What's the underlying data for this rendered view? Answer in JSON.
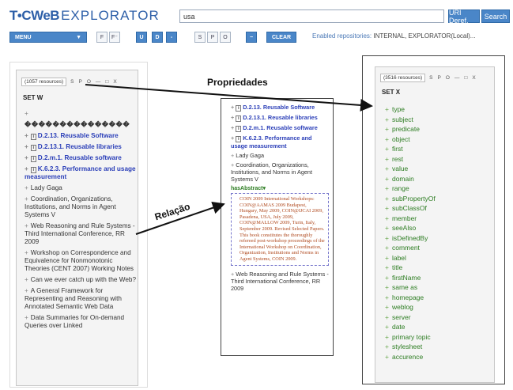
{
  "header": {
    "logo_main": "T•CWeB",
    "logo_sub": "EXPLORATOR",
    "search_value": "usa",
    "uri_button": "URI Deref.",
    "search_button": "Search"
  },
  "toolbar": {
    "menu_label": "MENU",
    "buttons_a": [
      "F",
      "F⁻"
    ],
    "buttons_b": [
      "U",
      "D",
      "-"
    ],
    "buttons_c": [
      "S",
      "P",
      "O"
    ],
    "minus_label": "−",
    "clear_label": "CLEAR",
    "repos_label": "Enabled repositories:",
    "repos_value": "INTERNAL, EXPLORATOR(Local)..."
  },
  "left_panel": {
    "count": "(1057 resources)",
    "controls": [
      "S",
      "P",
      "O",
      "—",
      "□",
      "X"
    ],
    "title": "SET W",
    "items": [
      {
        "text": "",
        "link": false,
        "icon": false
      },
      {
        "text": "���������������",
        "link": false,
        "icon": false,
        "bullet": false
      },
      {
        "text": "D.2.13. Reusable Software",
        "link": true,
        "icon": true
      },
      {
        "text": "D.2.13.1. Reusable libraries",
        "link": true,
        "icon": true
      },
      {
        "text": "D.2.m.1. Reusable software",
        "link": true,
        "icon": true
      },
      {
        "text": "K.6.2.3. Performance and usage measurement",
        "link": true,
        "icon": true
      },
      {
        "text": "Lady Gaga",
        "link": false,
        "icon": false
      },
      {
        "text": "Coordination, Organizations, Institutions, and Norms in Agent Systems V",
        "link": false,
        "icon": false
      },
      {
        "text": "Web Reasoning and Rule Systems - Third International Conference, RR 2009",
        "link": false,
        "icon": false
      },
      {
        "text": "Workshop on Correspondence and Equivalence for Nonmonotonic Theories (CENT 2007) Working Notes",
        "link": false,
        "icon": false
      },
      {
        "text": "Can we ever catch up with the Web?",
        "link": false,
        "icon": false
      },
      {
        "text": "A General Framework for Representing and Reasoning with Annotated Semantic Web Data",
        "link": false,
        "icon": false
      },
      {
        "text": "Data Summaries for On-demand Queries over Linked",
        "link": false,
        "icon": false
      }
    ]
  },
  "middle_panel": {
    "items": [
      {
        "text": "D.2.13. Reusable Software",
        "link": true
      },
      {
        "text": "D.2.13.1. Reusable libraries",
        "link": true
      },
      {
        "text": "D.2.m.1. Reusable software",
        "link": true
      },
      {
        "text": "K.6.2.3. Performance and usage measurement",
        "link": true
      },
      {
        "text": "Lady Gaga",
        "link": false
      },
      {
        "text": "Coordination, Organizations, Institutions, and Norms in Agent Systems V",
        "link": false
      }
    ],
    "abstract_label": "hasAbstract▾",
    "abstract_text": "COIN 2009 International Workshops: COIN@AAMAS 2009 Budapest, Hungary, May 2009, COIN@IJCAI 2009, Pasadena, USA, July 2009, COIN@MALLOW 2009, Turin, Italy, September 2009. Revised Selected Papers. This book constitutes the thoroughly refereed post-workshop proceedings of the International Workshop on Coordination, Organization, Institutions and Norms in Agent Systems, COIN 2009.",
    "footer_item": "Web Reasoning and Rule Systems - Third International Conference, RR 2009"
  },
  "right_panel": {
    "count": "(3516 resources)",
    "controls": [
      "S",
      "P",
      "O",
      "—",
      "□",
      "X"
    ],
    "title": "SET X",
    "properties": [
      "type",
      "subject",
      "predicate",
      "object",
      "first",
      "rest",
      "value",
      "domain",
      "range",
      "subPropertyOf",
      "subClassOf",
      "member",
      "seeAlso",
      "isDefinedBy",
      "comment",
      "label",
      "title",
      "firstName",
      "same as",
      "homepage",
      "weblog",
      "server",
      "date",
      "primary topic",
      "stylesheet",
      "accurence"
    ]
  },
  "annotations": {
    "propriedades": "Propriedades",
    "relacao": "Relação"
  },
  "colors": {
    "accent_blue": "#4a86c8",
    "link_blue": "#2b3fb8",
    "property_green": "#2d7d22",
    "abstract_brown": "#b04a1f"
  }
}
